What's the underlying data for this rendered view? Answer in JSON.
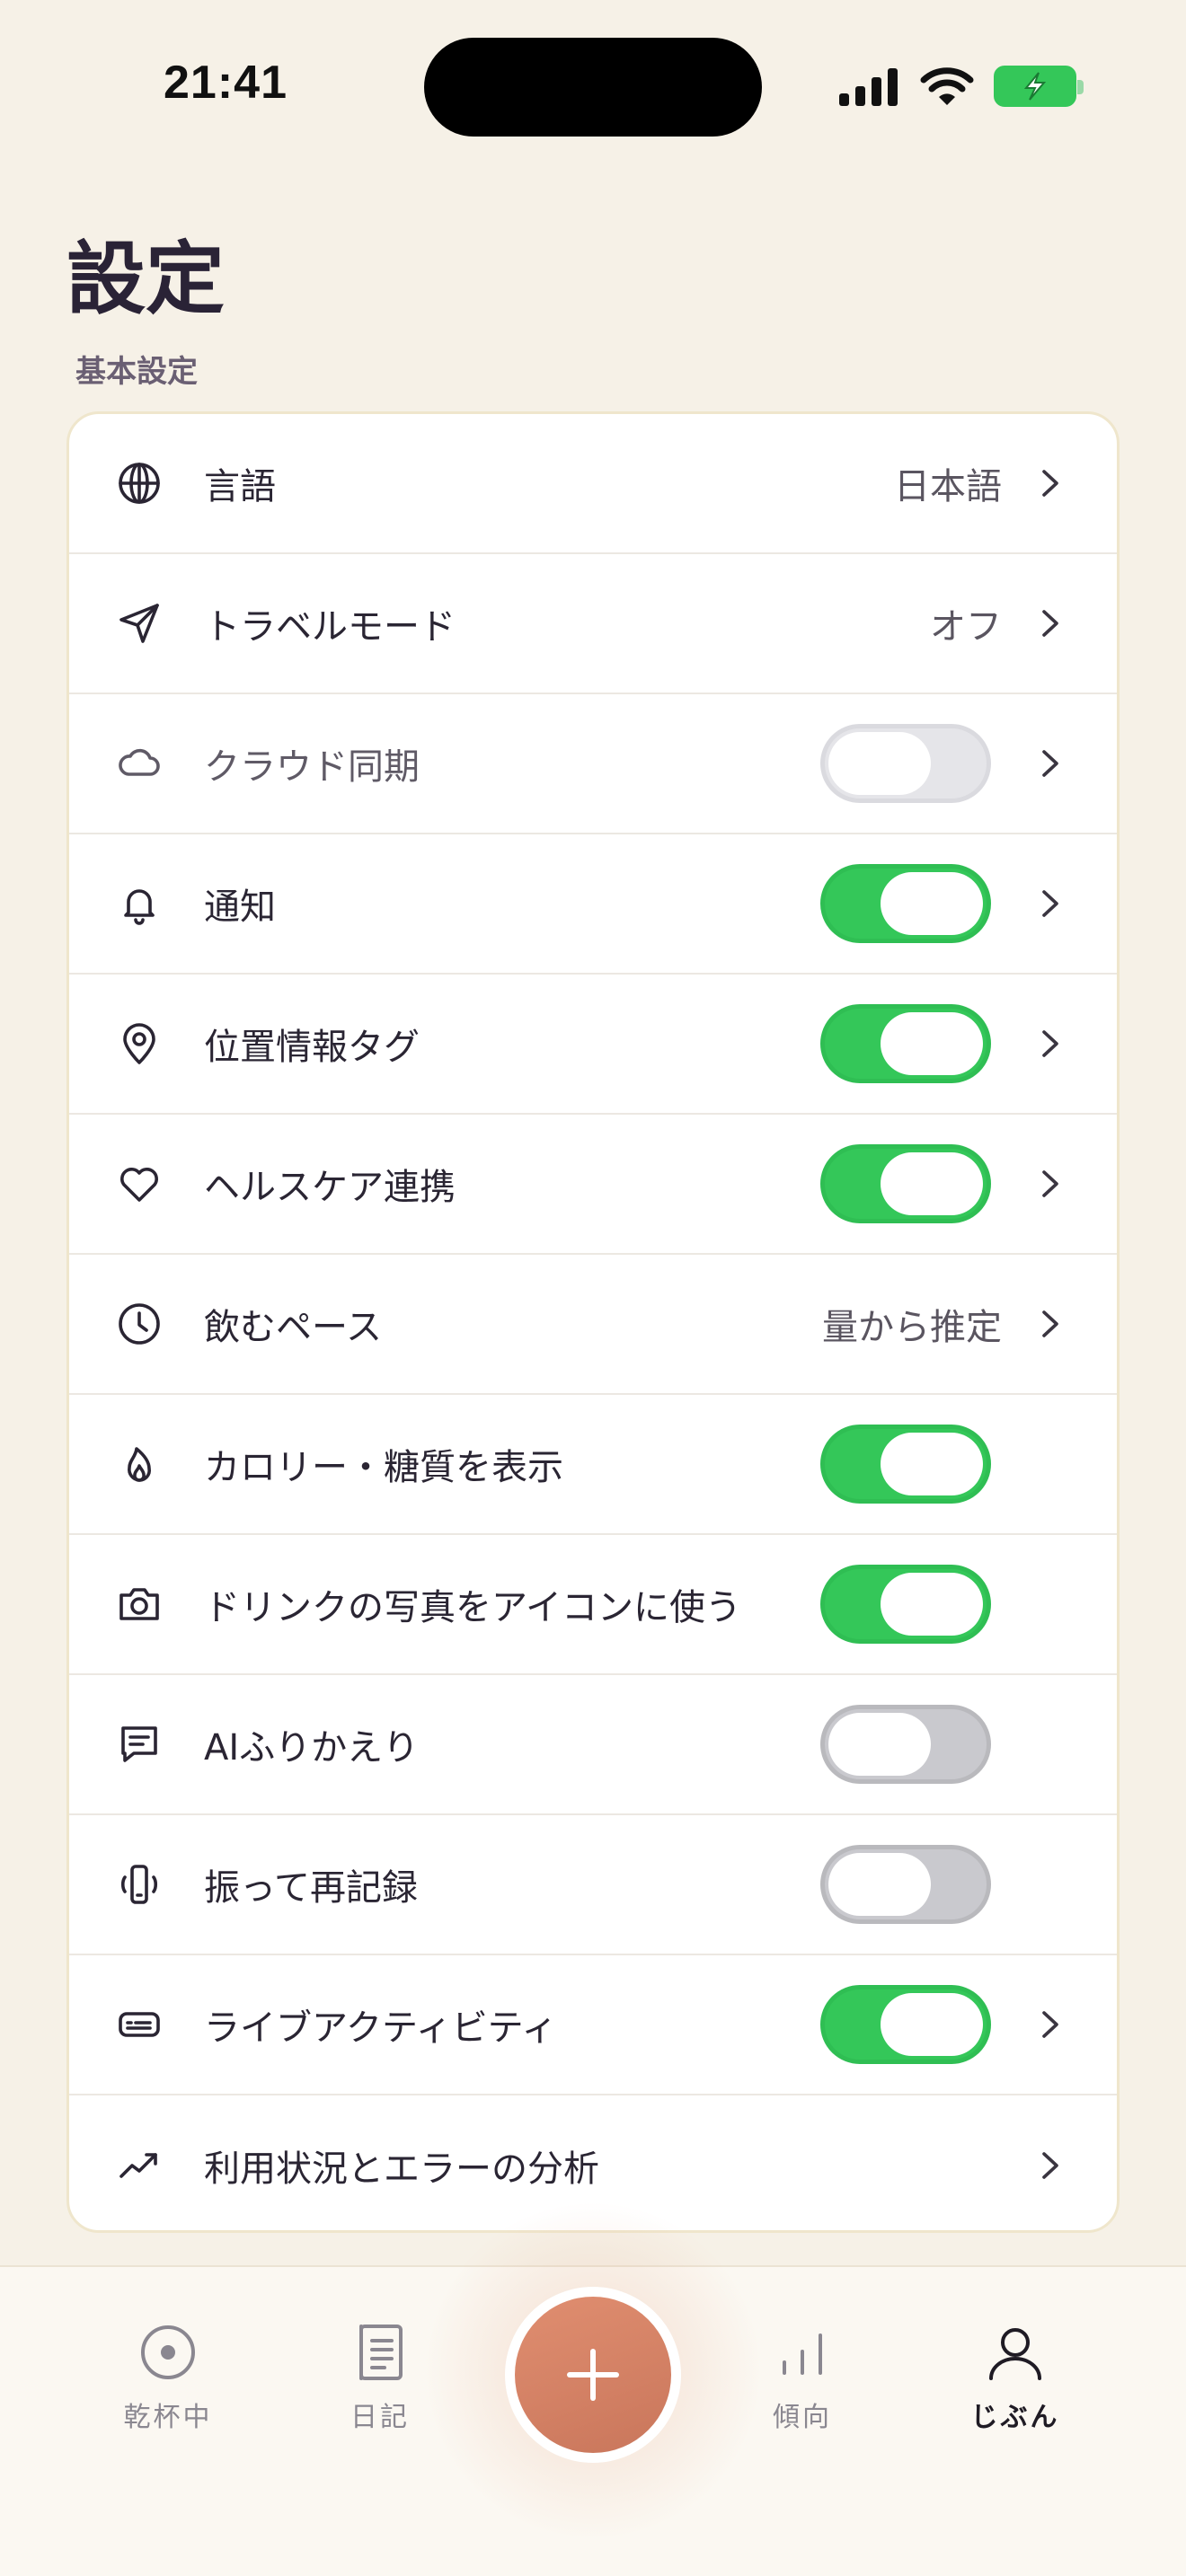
{
  "status_bar": {
    "time": "21:41"
  },
  "page": {
    "title": "設定",
    "section_label": "基本設定"
  },
  "settings": [
    {
      "label": "言語",
      "value": "日本語",
      "icon": "globe-icon",
      "chevron": true
    },
    {
      "label": "トラベルモード",
      "value": "オフ",
      "icon": "paper-plane-icon",
      "chevron": true
    },
    {
      "label": "クラウド同期",
      "toggle": "off",
      "icon": "cloud-icon",
      "chevron": true
    },
    {
      "label": "通知",
      "toggle": "on",
      "icon": "bell-icon",
      "chevron": true
    },
    {
      "label": "位置情報タグ",
      "toggle": "on",
      "icon": "map-pin-icon",
      "chevron": true
    },
    {
      "label": "ヘルスケア連携",
      "toggle": "on",
      "icon": "heart-icon",
      "chevron": true
    },
    {
      "label": "飲むペース",
      "value": "量から推定",
      "icon": "clock-icon",
      "chevron": true
    },
    {
      "label": "カロリー・糖質を表示",
      "toggle": "on",
      "icon": "flame-icon",
      "chevron": false
    },
    {
      "label": "ドリンクの写真をアイコンに使う",
      "toggle": "on",
      "icon": "camera-icon",
      "chevron": false
    },
    {
      "label": "AIふりかえり",
      "toggle": "off",
      "icon": "chat-icon",
      "chevron": false
    },
    {
      "label": "振って再記録",
      "toggle": "off",
      "icon": "phone-shake-icon",
      "chevron": false
    },
    {
      "label": "ライブアクティビティ",
      "toggle": "on",
      "icon": "live-activity-icon",
      "chevron": true
    },
    {
      "label": "利用状況とエラーの分析",
      "icon": "trend-icon",
      "chevron": true
    }
  ],
  "tab_bar": {
    "tabs": [
      {
        "label": "乾杯中",
        "icon": "target-icon"
      },
      {
        "label": "日記",
        "icon": "journal-icon"
      },
      {
        "label": "傾向",
        "icon": "bar-chart-icon"
      },
      {
        "label": "じぶん",
        "icon": "person-icon",
        "active": true
      }
    ],
    "add_button_icon": "plus-icon"
  },
  "colors": {
    "background": "#f6f1e7",
    "toggle_on": "#34c759",
    "fab": "#d4816a"
  }
}
